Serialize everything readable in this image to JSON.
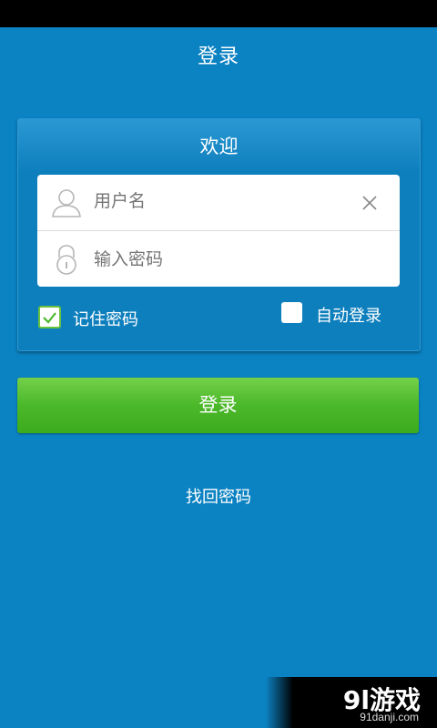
{
  "header": {
    "title": "登录"
  },
  "card": {
    "title": "欢迎",
    "username": {
      "placeholder": "用户名"
    },
    "password": {
      "placeholder": "输入密码"
    },
    "remember_password": {
      "label": "记住密码",
      "checked": true
    },
    "auto_login": {
      "label": "自动登录",
      "checked": false
    }
  },
  "login_button": {
    "label": "登录"
  },
  "forgot_password": {
    "label": "找回密码"
  },
  "watermark": {
    "logo": "9l游戏",
    "site": "91danji.com"
  },
  "icons": [
    "user-icon",
    "lock-icon",
    "clear-icon",
    "check-icon"
  ],
  "colors": {
    "background": "#0b82c2",
    "button_green": "#4bb82a",
    "check_green": "#6bc23e"
  }
}
